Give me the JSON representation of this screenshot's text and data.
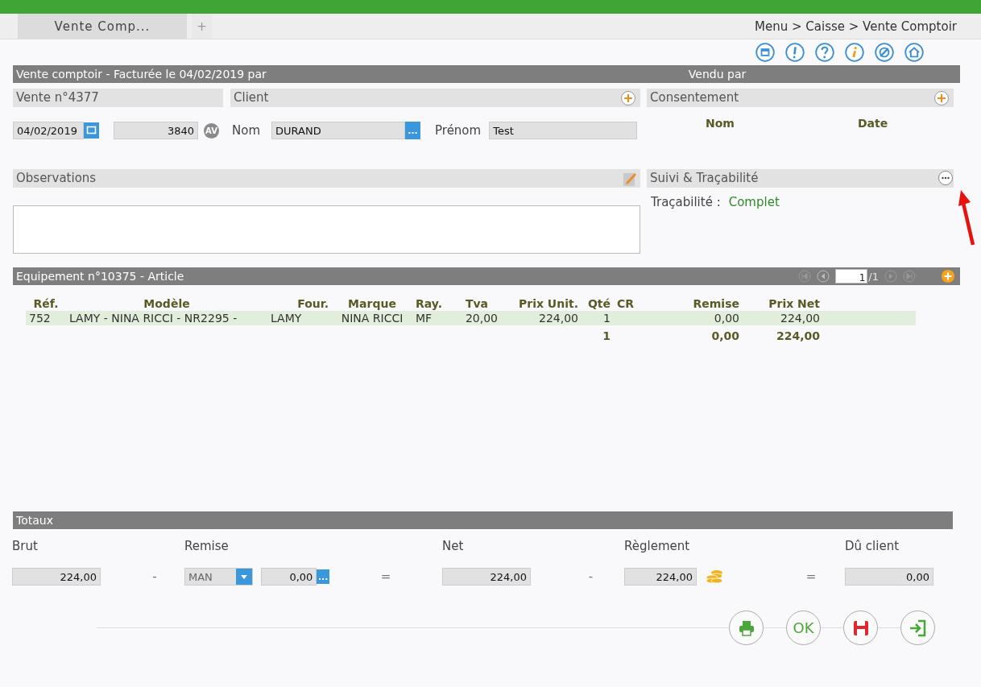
{
  "tabs": [
    {
      "label": "Vente Comp...",
      "selected": true
    },
    {
      "label": "+",
      "selected": false
    }
  ],
  "breadcrumb": "Menu > Caisse > Vente Comptoir",
  "title_bar": {
    "title": "Vente comptoir - Facturée le 04/02/2019 par",
    "right": "Vendu par"
  },
  "sale": {
    "header": "Vente n°4377",
    "date": "04/02/2019",
    "number": "3840",
    "badge": "AV"
  },
  "client": {
    "header": "Client",
    "nom_label": "Nom",
    "nom": "DURAND",
    "button": "...",
    "prenom_label": "Prénom",
    "prenom": "Test"
  },
  "consent": {
    "header": "Consentement",
    "columns": [
      "Nom",
      "Date"
    ]
  },
  "observations": {
    "header": "Observations"
  },
  "tracking": {
    "header": "Suivi & Traçabilité",
    "label": "Traçabilité :",
    "status": "Complet"
  },
  "equipment": {
    "title": "Equipement n°10375 - Article",
    "page": "1",
    "pages": "/1",
    "columns": [
      "Réf.",
      "Modèle",
      "Four.",
      "Marque",
      "Ray.",
      "Tva",
      "Prix Unit.",
      "Qté",
      "CR",
      "Remise",
      "Prix Net"
    ],
    "rows": [
      [
        "752",
        "LAMY - NINA RICCI - NR2295 -",
        "LAMY",
        "NINA RICCI",
        "MF",
        "20,00",
        "224,00",
        "1",
        "",
        "0,00",
        "224,00"
      ]
    ],
    "totals": {
      "qty": "1",
      "discount": "0,00",
      "net": "224,00"
    }
  },
  "totaux": {
    "title": "Totaux",
    "brut_label": "Brut",
    "brut": "224,00",
    "minus1": "-",
    "remise_label": "Remise",
    "remise_type": "MAN",
    "remise": "0,00",
    "remise_button": "...",
    "equals1": "=",
    "net_label": "Net",
    "net": "224,00",
    "minus2": "-",
    "reglement_label": "Règlement",
    "reglement": "224,00",
    "equals2": "=",
    "du_label": "Dû client",
    "du": "0,00"
  },
  "actions": [
    {
      "kind": "print"
    },
    {
      "kind": "ok",
      "label": "OK"
    },
    {
      "kind": "save"
    },
    {
      "kind": "exit"
    }
  ]
}
